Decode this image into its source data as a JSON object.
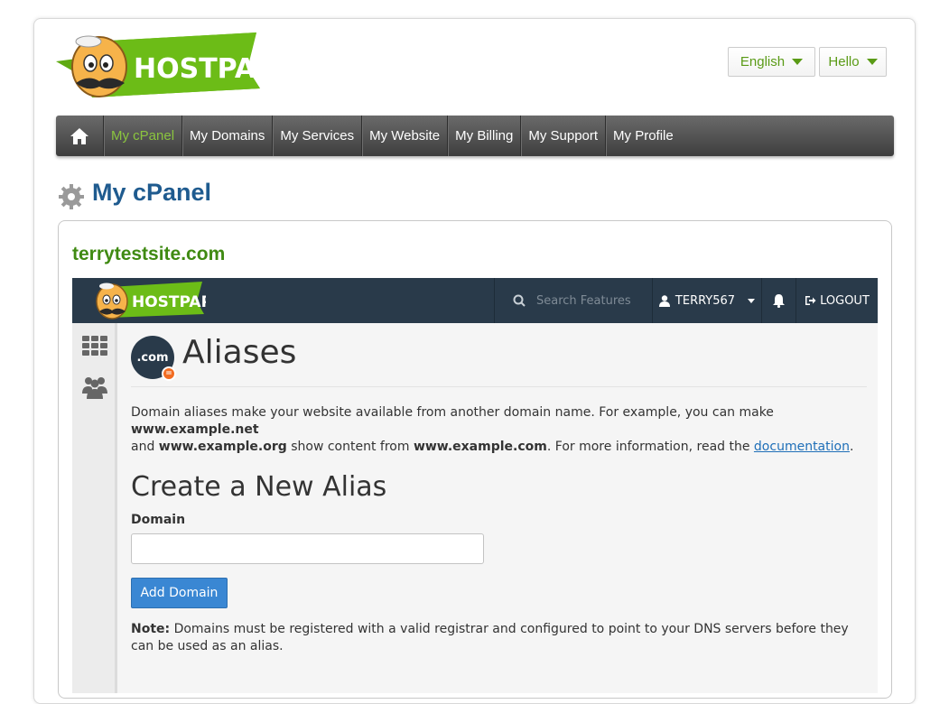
{
  "header": {
    "logo_text": "HOSTPAPA",
    "language_label": "English",
    "user_menu_label": "Hello"
  },
  "nav": {
    "items": [
      {
        "label": "My cPanel",
        "active": true
      },
      {
        "label": "My Domains"
      },
      {
        "label": "My Services"
      },
      {
        "label": "My Website"
      },
      {
        "label": "My Billing"
      },
      {
        "label": "My Support"
      },
      {
        "label": "My Profile"
      }
    ]
  },
  "page": {
    "title": "My cPanel",
    "site_name": "terrytestsite.com"
  },
  "cpanel": {
    "logo_text": "HOSTPAPA",
    "search_placeholder": "Search Features",
    "username": "TERRY567",
    "logout_label": "LOGOUT",
    "badge_text": ".com",
    "heading": "Aliases",
    "description": {
      "p1": "Domain aliases make your website available from another domain name. For example, you can make ",
      "b1": "www.example.net",
      "p2": "and ",
      "b2": "www.example.org",
      "p3": " show content from ",
      "b3": "www.example.com",
      "p4": ". For more information, read the ",
      "link": "documentation",
      "p5": "."
    },
    "create_heading": "Create a New Alias",
    "domain_label": "Domain",
    "domain_value": "",
    "add_button_label": "Add Domain",
    "note_label": "Note:",
    "note_text": " Domains must be registered with a valid registrar and configured to point to your DNS servers before they can be used as an alias."
  },
  "colors": {
    "brand_green": "#5a9b16",
    "nav_active": "#8bc53f",
    "title_blue": "#1f5b8f",
    "cpanel_dark": "#293a4a",
    "primary_button": "#3a87d3",
    "badge_orange": "#f26c22"
  }
}
